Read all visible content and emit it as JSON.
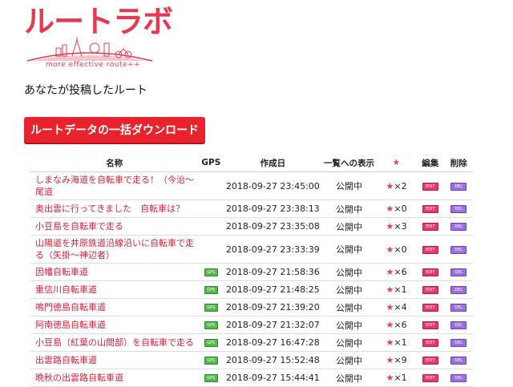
{
  "logo": {
    "title": "ルートラボ",
    "tagline": "more effective route++"
  },
  "section_title": "あなたが投稿したルート",
  "download_button": "ルートデータの一括ダウンロード",
  "table": {
    "headers": {
      "name": "名称",
      "gps": "GPS",
      "date": "作成日",
      "status": "一覧への表示",
      "star": "★",
      "edit": "編集",
      "delete": "削除"
    },
    "rows": [
      {
        "name": "しまなみ海道を自転車で走る！（今治～尾道",
        "gps": false,
        "date": "2018-09-27 23:45:00",
        "status": "公開中",
        "stars": "×2",
        "tall": true
      },
      {
        "name": "奥出雲に行ってきました　自転車は？",
        "gps": false,
        "date": "2018-09-27 23:38:13",
        "status": "公開中",
        "stars": "×0",
        "tall": false
      },
      {
        "name": "小豆島を自転車で走る",
        "gps": false,
        "date": "2018-09-27 23:35:08",
        "status": "公開中",
        "stars": "×3",
        "tall": false
      },
      {
        "name": "山陽道を井原鉄道沿線沿いに自転車で走る（矢掛～神辺者）",
        "gps": false,
        "date": "2018-09-27 23:33:39",
        "status": "公開中",
        "stars": "×0",
        "tall": true
      },
      {
        "name": "因幡自転車道",
        "gps": true,
        "date": "2018-09-27 21:58:36",
        "status": "公開中",
        "stars": "×6",
        "tall": false
      },
      {
        "name": "重信川自転車道",
        "gps": true,
        "date": "2018-09-27 21:48:25",
        "status": "公開中",
        "stars": "×1",
        "tall": false
      },
      {
        "name": "鳴門徳島自転車道",
        "gps": true,
        "date": "2018-09-27 21:39:20",
        "status": "公開中",
        "stars": "×4",
        "tall": false
      },
      {
        "name": "阿南徳島自転車道",
        "gps": true,
        "date": "2018-09-27 21:32:07",
        "status": "公開中",
        "stars": "×6",
        "tall": false
      },
      {
        "name": "小豆島（紅葉の山間部）を自転車で走る",
        "gps": true,
        "date": "2018-09-27 16:47:28",
        "status": "公開中",
        "stars": "×1",
        "tall": false
      },
      {
        "name": "出雲路自転車道",
        "gps": true,
        "date": "2018-09-27 15:52:48",
        "status": "公開中",
        "stars": "×9",
        "tall": false
      },
      {
        "name": "晩秋の出雲路自転車道",
        "gps": true,
        "date": "2018-09-27 15:44:41",
        "status": "公開中",
        "stars": "×1",
        "tall": false
      }
    ]
  },
  "colors": {
    "brand": "#e8384f",
    "link": "#d8213a",
    "button": "#e8232d",
    "star": "#e8385f",
    "gps_badge": "#55b848",
    "edit_badge": "#e8386a",
    "delete_badge": "#9b6fe0"
  }
}
